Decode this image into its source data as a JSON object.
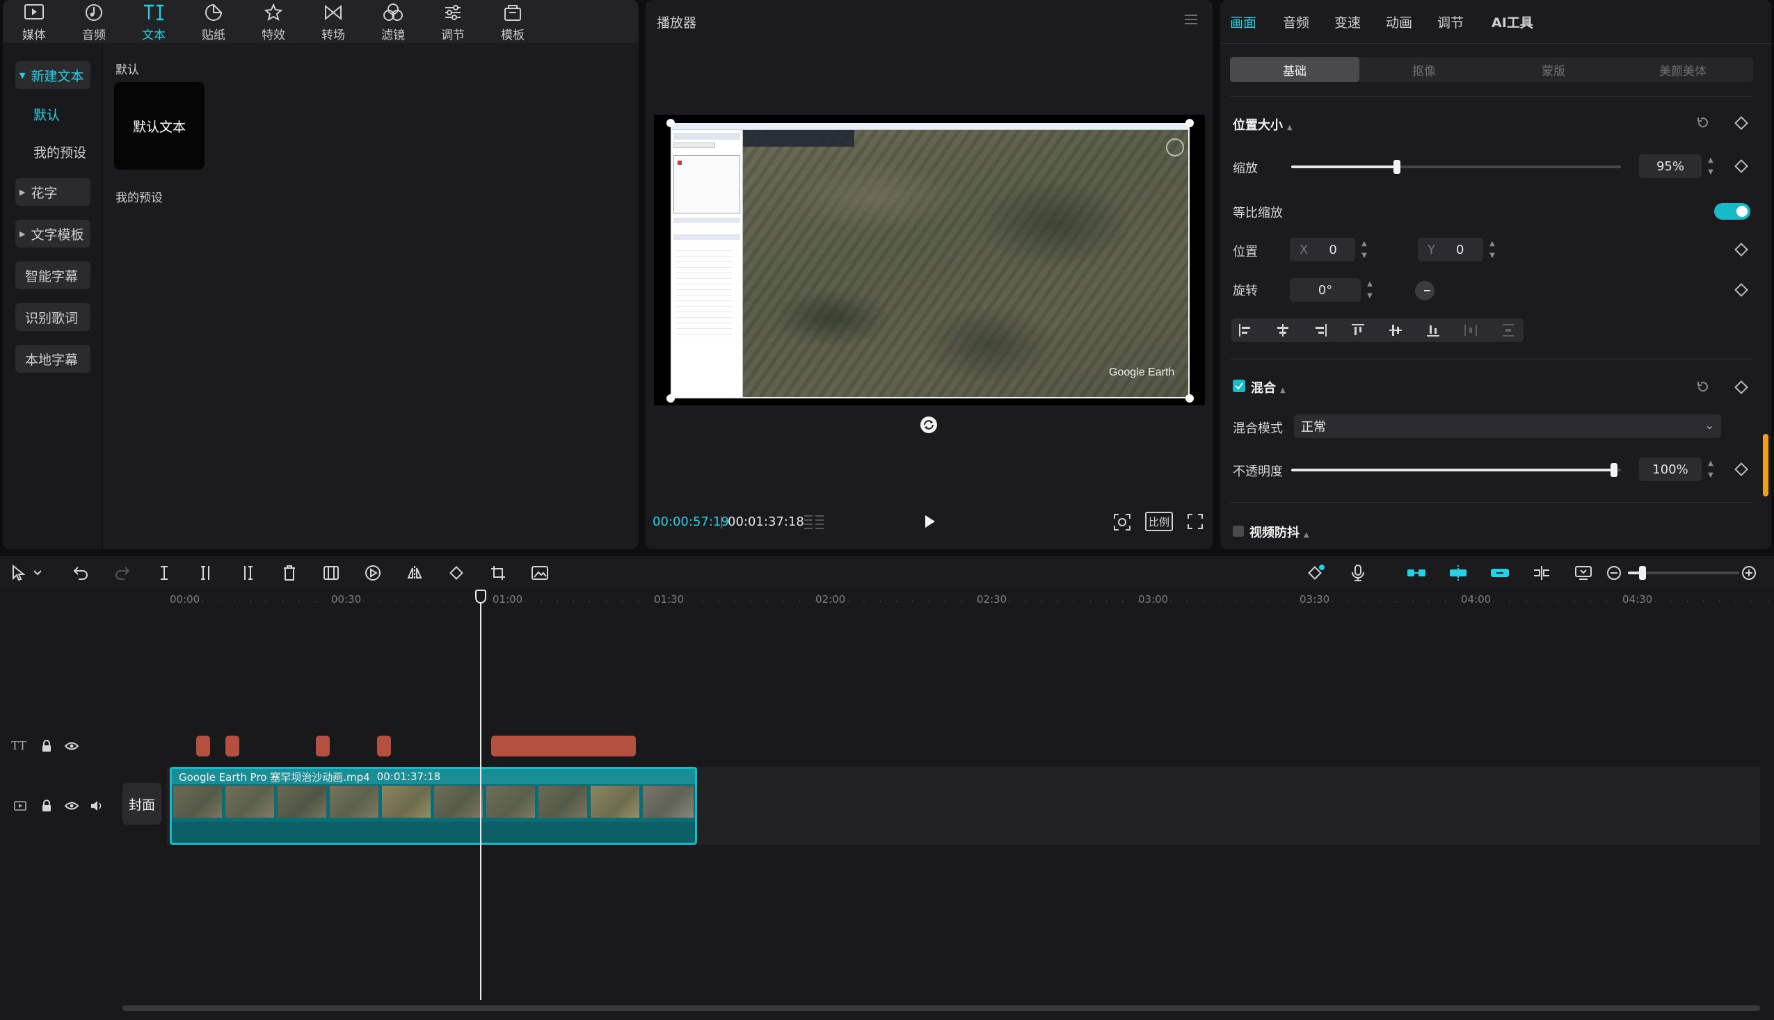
{
  "top_tabs": [
    {
      "label": "媒体",
      "icon": "media-icon"
    },
    {
      "label": "音频",
      "icon": "audio-icon"
    },
    {
      "label": "文本",
      "icon": "text-icon"
    },
    {
      "label": "贴纸",
      "icon": "sticker-icon"
    },
    {
      "label": "特效",
      "icon": "effects-icon"
    },
    {
      "label": "转场",
      "icon": "transition-icon"
    },
    {
      "label": "滤镜",
      "icon": "filter-icon"
    },
    {
      "label": "调节",
      "icon": "adjust-icon"
    },
    {
      "label": "模板",
      "icon": "template-icon"
    }
  ],
  "active_top_tab": "文本",
  "left_nav": {
    "new_text": "新建文本",
    "default": "默认",
    "my_presets": "我的预设",
    "fancy_text": "花字",
    "text_templates": "文字模板",
    "smart_captions": "智能字幕",
    "recognize_lyrics": "识别歌词",
    "local_captions": "本地字幕"
  },
  "library": {
    "default_section": "默认",
    "default_card": "默认文本",
    "presets_section": "我的预设"
  },
  "player": {
    "title": "播放器",
    "time_current": "00:00:57:19",
    "time_total": "00:01:37:18",
    "ratio_button": "比例",
    "watermark": "Google Earth"
  },
  "inspector": {
    "tabs": [
      "画面",
      "音频",
      "变速",
      "动画",
      "调节",
      "AI工具"
    ],
    "active_tab": "画面",
    "subtabs": [
      "基础",
      "抠像",
      "蒙版",
      "美颜美体"
    ],
    "active_subtab": "基础",
    "position_size": {
      "header": "位置大小",
      "scale_label": "缩放",
      "scale_value": "95%",
      "scale_fraction": 0.32,
      "uniform_label": "等比缩放",
      "uniform_on": true,
      "position_label": "位置",
      "x_label": "X",
      "x_value": "0",
      "y_label": "Y",
      "y_value": "0",
      "rotate_label": "旋转",
      "rotate_value": "0°"
    },
    "blend": {
      "header": "混合",
      "mode_label": "混合模式",
      "mode_value": "正常",
      "opacity_label": "不透明度",
      "opacity_value": "100%",
      "opacity_fraction": 1.0
    },
    "stabilize_header": "视频防抖"
  },
  "timeline": {
    "ruler_ticks": [
      "00:00",
      "00:30",
      "01:00",
      "01:30",
      "02:00",
      "02:30",
      "03:00",
      "03:30",
      "04:00",
      "04:30"
    ],
    "clip_name": "Google Earth Pro 塞罕坝治沙动画.mp4",
    "clip_duration": "00:01:37:18",
    "cover_label": "封面",
    "text_track_icon": "TT"
  },
  "colors": {
    "accent": "#22d3e6",
    "text_clip": "#b4503f",
    "video_clip_border": "#19b9c7"
  }
}
